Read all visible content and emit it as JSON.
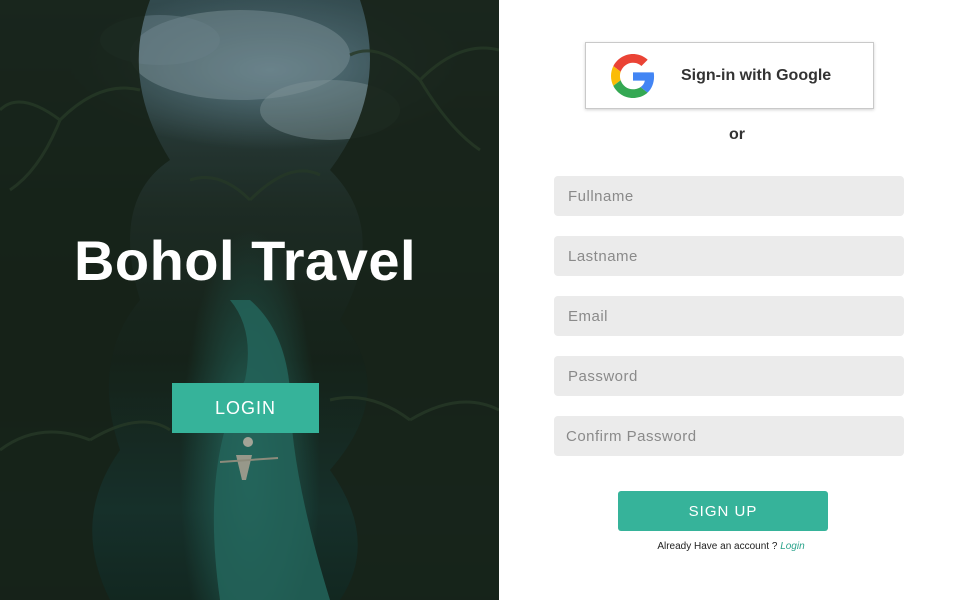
{
  "hero": {
    "title": "Bohol Travel",
    "login_label": "LOGIN"
  },
  "google": {
    "label": "Sign-in with Google",
    "icon": "google-g-icon"
  },
  "separator": "or",
  "form": {
    "fullname_placeholder": "Fullname",
    "lastname_placeholder": "Lastname",
    "email_placeholder": "Email",
    "password_placeholder": "Password",
    "confirm_password_placeholder": "Confirm Password"
  },
  "signup_label": "SIGN UP",
  "footer": {
    "prompt": "Already Have an account ?",
    "login_link": "Login"
  },
  "colors": {
    "accent": "#36b39a",
    "field_bg": "#ebebeb",
    "text": "#333333"
  }
}
